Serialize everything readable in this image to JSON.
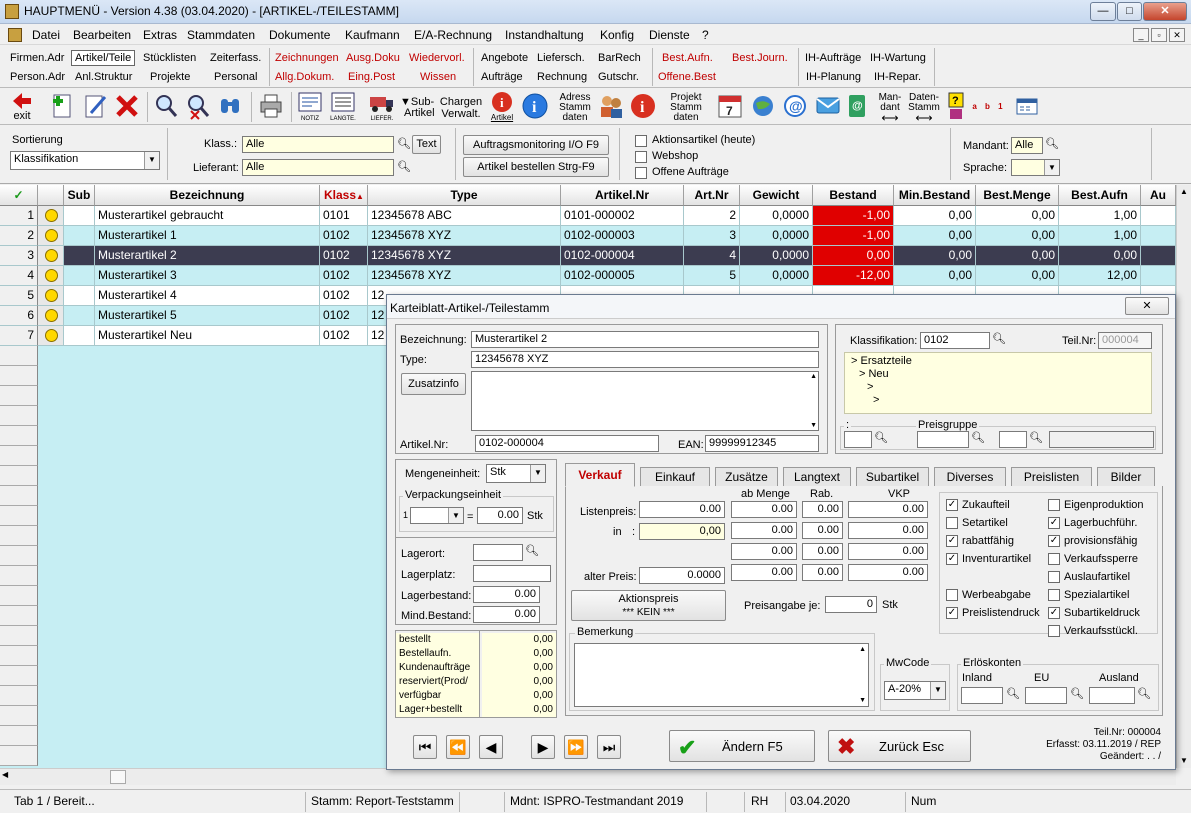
{
  "window": {
    "title": "HAUPTMENÜ  - Version 4.38 (03.04.2020) - [ARTIKEL-/TEILESTAMM]",
    "min": "—",
    "max": "□",
    "close": "✕"
  },
  "menu": [
    "Datei",
    "Bearbeiten",
    "Extras",
    "Stammdaten",
    "Dokumente",
    "Kaufmann",
    "E/A-Rechnung",
    "Instandhaltung",
    "Konfig",
    "Dienste",
    "?"
  ],
  "nav": {
    "row1": [
      "Firmen.Adr",
      "Artikel/Teile",
      "Stücklisten",
      "Zeiterfass.",
      "Zeichnungen",
      "Ausg.Doku",
      "Wiedervorl.",
      "Angebote",
      "Liefersch.",
      "BarRech",
      "Best.Aufn.",
      "Best.Journ.",
      "IH-Aufträge",
      "IH-Wartung"
    ],
    "row2": [
      "Person.Adr",
      "Anl.Struktur",
      "Projekte",
      "Personal",
      "Allg.Dokum.",
      "Eing.Post",
      "Wissen",
      "Aufträge",
      "Rechnung",
      "Gutschr.",
      "Offene.Best",
      "",
      "IH-Planung",
      "IH-Repar."
    ]
  },
  "toolbar": {
    "exit": "exit",
    "notiz": "NOTIZ",
    "langte": "LANGTE.",
    "liefer": "LIEFER.",
    "sub1": "Sub-",
    "sub2": "Artikel",
    "charg1": "Chargen",
    "charg2": "Verwalt.",
    "artikel": "Artikel",
    "adr1": "Adress",
    "adr2": "Stamm",
    "adr3": "daten",
    "proj1": "Projekt",
    "proj2": "Stamm",
    "proj3": "daten",
    "cal": "7",
    "man1": "Man-",
    "man2": "dant",
    "dat1": "Daten-",
    "dat2": "Stamm",
    "sort_letters": "a b 1 2 3"
  },
  "filter": {
    "sort_label": "Sortierung",
    "sort_value": "Klassifikation",
    "klass_label": "Klass.:",
    "klass_value": "Alle",
    "text_btn": "Text",
    "lief_label": "Lieferant:",
    "lief_value": "Alle",
    "btn_monitor": "Auftragsmonitoring I/O  F9",
    "btn_bestellen": "Artikel bestellen Strg-F9",
    "chk_aktion": "Aktionsartikel (heute)",
    "chk_webshop": "Webshop",
    "chk_offene": "Offene Aufträge",
    "mandant_label": "Mandant:",
    "mandant_value": "Alle",
    "sprache_label": "Sprache:"
  },
  "columns": [
    "✓",
    "",
    "Sub",
    "Bezeichnung",
    "Klass",
    "Type",
    "Artikel.Nr",
    "Art.Nr",
    "Gewicht",
    "Bestand",
    "Min.Bestand",
    "Best.Menge",
    "Best.Aufn",
    "Au"
  ],
  "rows": [
    {
      "n": "1",
      "bez": "Musterartikel gebraucht",
      "klass": "0101",
      "type": "12345678 ABC",
      "artnr": "0101-000002",
      "nr": "2",
      "gew": "0,0000",
      "bestand": "-1,00",
      "min": "0,00",
      "bmenge": "0,00",
      "baufn": "1,00"
    },
    {
      "n": "2",
      "bez": "Musterartikel 1",
      "klass": "0102",
      "type": "12345678 XYZ",
      "artnr": "0102-000003",
      "nr": "3",
      "gew": "0,0000",
      "bestand": "-1,00",
      "min": "0,00",
      "bmenge": "0,00",
      "baufn": "1,00"
    },
    {
      "n": "3",
      "bez": "Musterartikel 2",
      "klass": "0102",
      "type": "12345678 XYZ",
      "artnr": "0102-000004",
      "nr": "4",
      "gew": "0,0000",
      "bestand": "0,00",
      "min": "0,00",
      "bmenge": "0,00",
      "baufn": "0,00"
    },
    {
      "n": "4",
      "bez": "Musterartikel 3",
      "klass": "0102",
      "type": "12345678 XYZ",
      "artnr": "0102-000005",
      "nr": "5",
      "gew": "0,0000",
      "bestand": "-12,00",
      "min": "0,00",
      "bmenge": "0,00",
      "baufn": "12,00"
    },
    {
      "n": "5",
      "bez": "Musterartikel 4",
      "klass": "0102",
      "type": "12",
      "artnr": "",
      "nr": "",
      "gew": "",
      "bestand": "",
      "min": "",
      "bmenge": "",
      "baufn": ""
    },
    {
      "n": "6",
      "bez": "Musterartikel 5",
      "klass": "0102",
      "type": "12",
      "artnr": "",
      "nr": "",
      "gew": "",
      "bestand": "",
      "min": "",
      "bmenge": "",
      "baufn": ""
    },
    {
      "n": "7",
      "bez": "Musterartikel Neu",
      "klass": "0102",
      "type": "12",
      "artnr": "",
      "nr": "",
      "gew": "",
      "bestand": "",
      "min": "",
      "bmenge": "",
      "baufn": ""
    }
  ],
  "status": {
    "tab": "Tab 1 / Bereit...",
    "stamm": "Stamm: Report-Teststamm",
    "mdnt": "Mdnt: ISPRO-Testmandant 2019",
    "user": "RH",
    "date": "03.04.2020",
    "num": "Num"
  },
  "dialog": {
    "title": "Karteiblatt-Artikel-/Teilestamm",
    "close": "✕",
    "bez_label": "Bezeichnung:",
    "bez_value": "Musterartikel 2",
    "type_label": "Type:",
    "type_value": "12345678 XYZ",
    "zusatz_btn": "Zusatzinfo",
    "artnr_label": "Artikel.Nr:",
    "artnr_value": "0102-000004",
    "ean_label": "EAN:",
    "ean_value": "99999912345",
    "klass_label": "Klassifikation:",
    "klass_value": "0102",
    "teilnr_label": "Teil.Nr:",
    "teilnr_value": "000004",
    "tree": [
      "> Ersatzteile",
      "> Neu",
      ">",
      ">"
    ],
    "colon": ":",
    "preisgruppe": "Preisgruppe",
    "me_label": "Mengeneinheit:",
    "me_value": "Stk",
    "vpe_group": "Verpackungseinheit",
    "vpe_num": "1",
    "vpe_eq": "=",
    "vpe_val": "0.00",
    "vpe_unit": "Stk",
    "lagerort": "Lagerort:",
    "lagerplatz": "Lagerplatz:",
    "lagerbestand": "Lagerbestand:",
    "lagerbestand_val": "0.00",
    "mindbestand": "Mind.Bestand:",
    "mindbestand_val": "0.00",
    "summary": [
      {
        "k": "bestellt",
        "v": "0,00"
      },
      {
        "k": "Bestellaufn.",
        "v": "0,00"
      },
      {
        "k": "Kundenaufträge",
        "v": "0,00"
      },
      {
        "k": "reserviert(Prod/",
        "v": "0,00"
      },
      {
        "k": "verfügbar",
        "v": "0,00"
      },
      {
        "k": "Lager+bestellt",
        "v": "0,00"
      }
    ],
    "tabs": [
      "Verkauf",
      "Einkauf",
      "Zusätze",
      "Langtext",
      "Subartikel",
      "Diverses",
      "Preislisten",
      "Bilder"
    ],
    "listenpreis_label": "Listenpreis:",
    "listenpreis": "0.00",
    "in_label": "in",
    "in_colon": ":",
    "in_value": "0,00",
    "ab_menge": "ab Menge",
    "rab": "Rab.",
    "vkp": "VKP",
    "price_rows": [
      [
        "0.00",
        "0.00",
        "0.00"
      ],
      [
        "0.00",
        "0.00",
        "0.00"
      ],
      [
        "0.00",
        "0.00",
        "0.00"
      ],
      [
        "0.00",
        "0.00",
        "0.00"
      ]
    ],
    "alter_preis_label": "alter Preis:",
    "alter_preis": "0.0000",
    "aktionspreis": "Aktionspreis",
    "aktionspreis_val": "*** KEIN ***",
    "preisangabe_label": "Preisangabe je:",
    "preisangabe": "0",
    "preisangabe_unit": "Stk",
    "checks_left": [
      {
        "l": "Zukaufteil",
        "c": true
      },
      {
        "l": "Setartikel",
        "c": false
      },
      {
        "l": "rabattfähig",
        "c": true
      },
      {
        "l": "Inventurartikel",
        "c": true
      },
      {
        "l": "",
        "c": null
      },
      {
        "l": "Werbeabgabe",
        "c": false
      },
      {
        "l": "Preislistendruck",
        "c": true
      }
    ],
    "checks_right": [
      {
        "l": "Eigenproduktion",
        "c": false
      },
      {
        "l": "Lagerbuchführ.",
        "c": true
      },
      {
        "l": "provisionsfähig",
        "c": true
      },
      {
        "l": "Verkaufssperre",
        "c": false
      },
      {
        "l": "Auslaufartikel",
        "c": false
      },
      {
        "l": "Spezialartikel",
        "c": false
      },
      {
        "l": "Subartikeldruck",
        "c": true
      },
      {
        "l": "Verkaufsstückl.",
        "c": false
      }
    ],
    "bemerkung": "Bemerkung",
    "mwcode": "MwCode",
    "mwcode_val": "A-20%",
    "erloes": "Erlöskonten",
    "inland": "Inland",
    "eu": "EU",
    "ausland": "Ausland",
    "aendern": "Ändern  F5",
    "zurueck": "Zurück  Esc",
    "teilnr_footer": "Teil.Nr: 000004",
    "erfasst": "Erfasst: 03.11.2019 / REP",
    "geaendert": "Geändert:   .   .   /"
  }
}
